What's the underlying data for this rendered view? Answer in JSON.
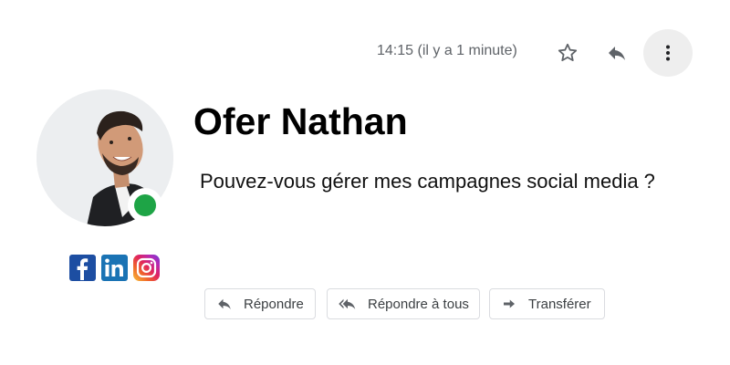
{
  "header": {
    "timestamp": "14:15 (il y a 1 minute)",
    "icons": {
      "star": "star-icon",
      "reply": "reply-icon",
      "more": "more-vert-icon"
    }
  },
  "sender": {
    "name": "Ofer Nathan",
    "status_color": "#1ea446",
    "avatar": "avatar-photo"
  },
  "message": {
    "body": "Pouvez-vous gérer mes campagnes social media ?"
  },
  "social": [
    {
      "network": "facebook",
      "glyph": "f",
      "color": "#1d4ea2"
    },
    {
      "network": "linkedin",
      "glyph": "in",
      "color": "#1a73b4"
    },
    {
      "network": "instagram",
      "glyph": "instagram-icon",
      "color": "#e0245e"
    }
  ],
  "actions": {
    "reply_label": "Répondre",
    "reply_all_label": "Répondre à tous",
    "forward_label": "Transférer"
  }
}
